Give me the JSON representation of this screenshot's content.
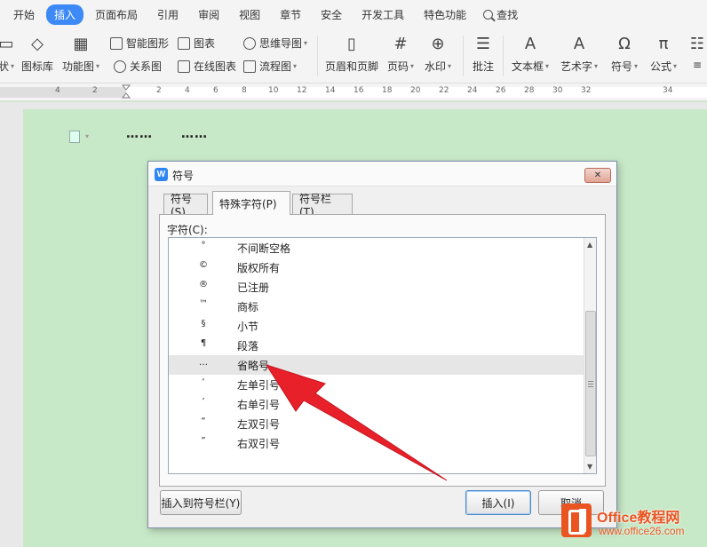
{
  "menubar": {
    "items": [
      "开始",
      "插入",
      "页面布局",
      "引用",
      "审阅",
      "视图",
      "章节",
      "安全",
      "开发工具",
      "特色功能"
    ],
    "active_index": 1,
    "search_label": "查找"
  },
  "ribbon": {
    "picture_library": "图标库",
    "function_chart": "功能图",
    "smart_shape": "智能图形",
    "chart": "图表",
    "relation_chart": "关系图",
    "online_chart": "在线图表",
    "mind_map": "思维导图",
    "flow_chart": "流程图",
    "header_footer": "页眉和页脚",
    "page_number": "页码",
    "watermark": "水印",
    "comment": "批注",
    "textbox": "文本框",
    "wordart": "艺术字",
    "symbol": "符号",
    "formula": "公式",
    "partial_left": "状"
  },
  "ruler": {
    "numbers": [
      "4",
      "2",
      "2",
      "4",
      "6",
      "8",
      "10",
      "12",
      "14",
      "16",
      "18",
      "20",
      "22",
      "24",
      "26",
      "28",
      "30",
      "32",
      "34"
    ]
  },
  "document": {
    "text_1": "……",
    "text_2": "……"
  },
  "dialog": {
    "title": "符号",
    "close_glyph": "✕",
    "tabs": [
      "符号(S)",
      "特殊字符(P)",
      "符号栏(T)"
    ],
    "active_tab": 1,
    "list_label": "字符(C):",
    "rows": [
      {
        "symbol": "°",
        "name": "不间断空格"
      },
      {
        "symbol": "©",
        "name": "版权所有"
      },
      {
        "symbol": "®",
        "name": "已注册"
      },
      {
        "symbol": "™",
        "name": "商标"
      },
      {
        "symbol": "§",
        "name": "小节"
      },
      {
        "symbol": "¶",
        "name": "段落"
      },
      {
        "symbol": "…",
        "name": "省略号"
      },
      {
        "symbol": "‘",
        "name": "左单引号"
      },
      {
        "symbol": "’",
        "name": "右单引号"
      },
      {
        "symbol": "“",
        "name": "左双引号"
      },
      {
        "symbol": "”",
        "name": "右双引号"
      }
    ],
    "highlighted_row": 6,
    "insert_to_bar_button": "插入到符号栏(Y)",
    "insert_button": "插入(I)",
    "cancel_button": "取消"
  },
  "watermark": {
    "line1": "Office教程网",
    "line2": "www.office26.com"
  },
  "colors": {
    "accent": "#3d8af7",
    "page_bg": "#c8e9c8",
    "arrow": "#e8202a",
    "brand": "#e95420"
  }
}
